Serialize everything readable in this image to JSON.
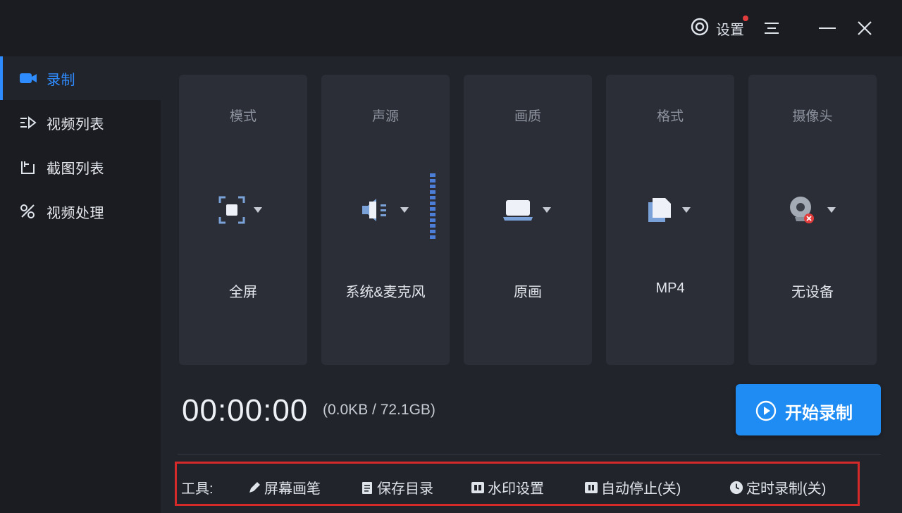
{
  "titlebar": {
    "settings_label": "设置"
  },
  "sidebar": {
    "items": [
      {
        "label": "录制",
        "icon": "camera-icon",
        "active": true
      },
      {
        "label": "视频列表",
        "icon": "video-list-icon"
      },
      {
        "label": "截图列表",
        "icon": "screenshot-list-icon"
      },
      {
        "label": "视频处理",
        "icon": "video-tools-icon"
      }
    ]
  },
  "cards": [
    {
      "title": "模式",
      "value": "全屏",
      "icon": "fullscreen-icon"
    },
    {
      "title": "声源",
      "value": "系统&麦克风",
      "icon": "speaker-icon"
    },
    {
      "title": "画质",
      "value": "原画",
      "icon": "monitor-icon"
    },
    {
      "title": "格式",
      "value": "MP4",
      "icon": "file-icon"
    },
    {
      "title": "摄像头",
      "value": "无设备",
      "icon": "webcam-icon"
    }
  ],
  "record": {
    "timer": "00:00:00",
    "size": "(0.0KB / 72.1GB)",
    "start_label": "开始录制"
  },
  "tools": {
    "label": "工具:",
    "items": [
      {
        "label": "屏幕画笔",
        "icon": "pen-icon"
      },
      {
        "label": "保存目录",
        "icon": "folder-doc-icon"
      },
      {
        "label": "水印设置",
        "icon": "watermark-icon"
      },
      {
        "label": "自动停止(关)",
        "icon": "pause-icon"
      },
      {
        "label": "定时录制(关)",
        "icon": "clock-icon"
      }
    ]
  },
  "colors": {
    "accent": "#2f8cff",
    "start_button": "#1e8cf3",
    "highlight_border": "#d6292a",
    "notification_dot": "#e23c3c"
  }
}
